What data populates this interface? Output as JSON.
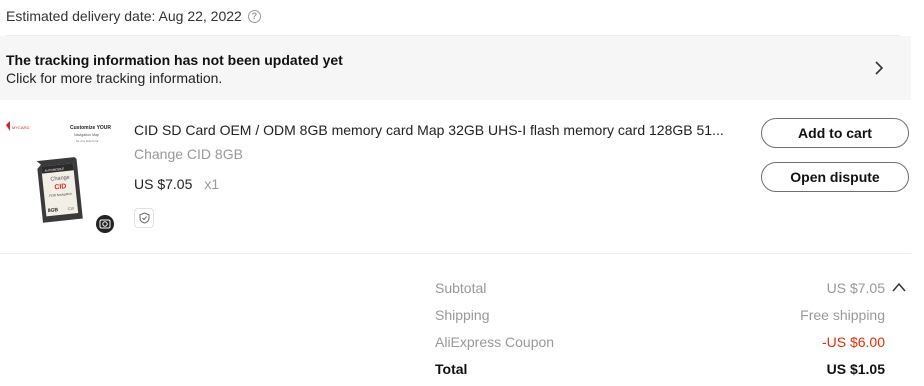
{
  "delivery": {
    "text": "Estimated delivery date: Aug 22, 2022",
    "help_glyph": "?"
  },
  "tracking": {
    "title": "The tracking information has not been updated yet",
    "subtitle": "Click for more tracking information."
  },
  "product": {
    "title": "CID SD Card OEM / ODM 8GB memory card Map 32GB UHS-I flash memory card 128GB 51...",
    "variant": "Change CID 8GB",
    "price": "US $7.05",
    "quantity": "x1",
    "image": {
      "brand": "MYCARD",
      "heading": "Customize YOUR",
      "line2": "Navigation Map",
      "line3": "for any brand car",
      "card_top": "AUTOMOBILE",
      "card_change": "Change",
      "card_cid": "CID",
      "card_sub": "FOR Navigation",
      "card_size": "8GB",
      "card_class": "C10"
    },
    "buttons": {
      "add_to_cart": "Add to cart",
      "open_dispute": "Open dispute"
    }
  },
  "summary": {
    "subtotal_label": "Subtotal",
    "subtotal_value": "US $7.05",
    "shipping_label": "Shipping",
    "shipping_value": "Free shipping",
    "coupon_label": "AliExpress Coupon",
    "coupon_value": "-US $6.00",
    "total_label": "Total",
    "total_value": "US $1.05"
  },
  "colors": {
    "accent_red": "#e62e04",
    "muted_text": "#999999",
    "tracking_bg": "#f6f6f6"
  }
}
